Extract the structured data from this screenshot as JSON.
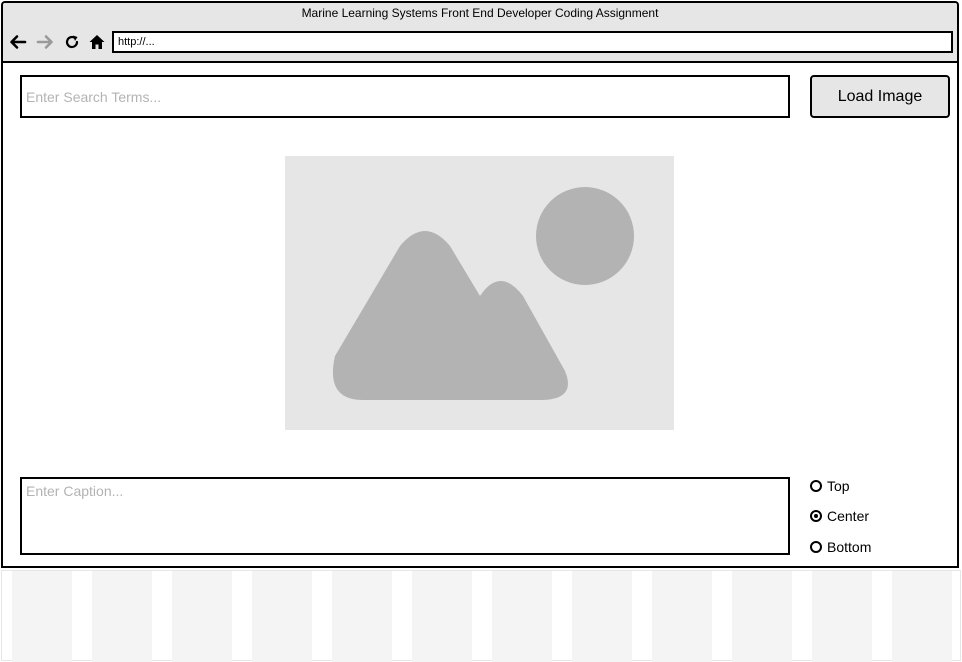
{
  "window": {
    "title": "Marine Learning Systems Front End Developer Coding Assignment",
    "url": "http://..."
  },
  "nav": {
    "icons": [
      "back-arrow-icon",
      "forward-arrow-icon",
      "refresh-icon",
      "home-icon"
    ]
  },
  "search": {
    "placeholder": "Enter Search Terms...",
    "value": ""
  },
  "load_button": {
    "label": "Load Image"
  },
  "image": {
    "icon": "image-placeholder-icon"
  },
  "caption": {
    "placeholder": "Enter Caption...",
    "value": ""
  },
  "position": {
    "selected": "Center",
    "options": [
      {
        "label": "Top",
        "checked": false
      },
      {
        "label": "Center",
        "checked": true
      },
      {
        "label": "Bottom",
        "checked": false
      }
    ]
  },
  "colors": {
    "chrome_bg": "#e6e6e6",
    "placeholder_text": "#b3b3b3",
    "image_bg": "#e6e6e6",
    "image_shape": "#b3b3b3"
  }
}
